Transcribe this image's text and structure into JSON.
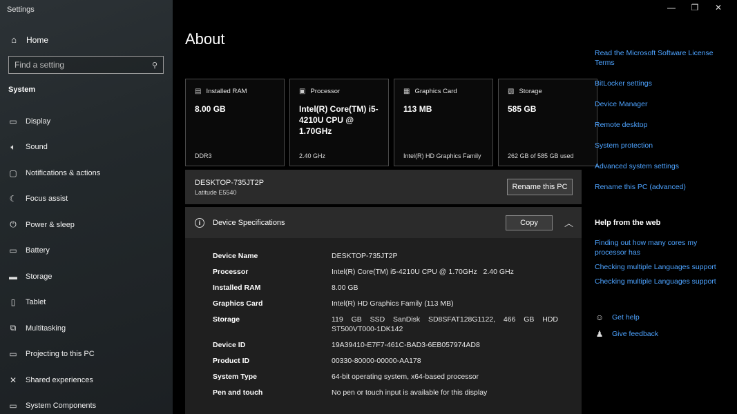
{
  "window": {
    "title": "Settings",
    "controls": [
      "—",
      "❐",
      "✕"
    ]
  },
  "sidebar": {
    "home_label": "Home",
    "search": {
      "placeholder": "Find a setting"
    },
    "section": "System",
    "items": [
      {
        "label": "Display",
        "icon": "display-icon"
      },
      {
        "label": "Sound",
        "icon": "sound-icon"
      },
      {
        "label": "Notifications & actions",
        "icon": "notifications-icon"
      },
      {
        "label": "Focus assist",
        "icon": "focus-assist-icon"
      },
      {
        "label": "Power & sleep",
        "icon": "power-icon"
      },
      {
        "label": "Battery",
        "icon": "battery-icon"
      },
      {
        "label": "Storage",
        "icon": "storage-icon"
      },
      {
        "label": "Tablet",
        "icon": "tablet-icon"
      },
      {
        "label": "Multitasking",
        "icon": "multitasking-icon"
      },
      {
        "label": "Projecting to this PC",
        "icon": "projecting-icon"
      },
      {
        "label": "Shared experiences",
        "icon": "shared-icon"
      },
      {
        "label": "System Components",
        "icon": "components-icon"
      }
    ]
  },
  "main": {
    "title": "About",
    "cards": [
      {
        "label": "Installed RAM",
        "value": "8.00 GB",
        "sub": "DDR3",
        "icon": "ram-icon"
      },
      {
        "label": "Processor",
        "value": "Intel(R) Core(TM) i5-4210U CPU @ 1.70GHz",
        "sub": "2.40 GHz",
        "icon": "processor-icon"
      },
      {
        "label": "Graphics Card",
        "value": "113 MB",
        "sub": "Intel(R) HD Graphics Family",
        "icon": "graphics-icon"
      },
      {
        "label": "Storage",
        "value": "585 GB",
        "sub": "262 GB of 585 GB used",
        "icon": "storage-icon"
      }
    ],
    "pc": {
      "name": "DESKTOP-735JT2P",
      "model": "Latitude E5540",
      "rename_label": "Rename this PC"
    },
    "specs": {
      "title": "Device Specifications",
      "copy_label": "Copy",
      "rows": [
        {
          "key": "Device Name",
          "value": "DESKTOP-735JT2P"
        },
        {
          "key": "Processor",
          "value": "Intel(R) Core(TM) i5-4210U CPU @ 1.70GHz   2.40 GHz"
        },
        {
          "key": "Installed RAM",
          "value": "8.00 GB"
        },
        {
          "key": "Graphics Card",
          "value": "Intel(R) HD Graphics Family (113 MB)"
        },
        {
          "key": "Storage",
          "value": "119 GB SSD SanDisk SD8SFAT128G1122, 466 GB HDD ST500VT000-1DK142"
        },
        {
          "key": "Device ID",
          "value": "19A39410-E7F7-461C-BAD3-6EB057974AD8"
        },
        {
          "key": "Product ID",
          "value": "00330-80000-00000-AA178"
        },
        {
          "key": "System Type",
          "value": "64-bit operating system, x64-based processor"
        },
        {
          "key": "Pen and touch",
          "value": "No pen or touch input is available for this display"
        }
      ]
    }
  },
  "related": {
    "links": [
      "Read the Microsoft Software License Terms",
      "BitLocker settings",
      "Device Manager",
      "Remote desktop",
      "System protection",
      "Advanced system settings",
      "Rename this PC (advanced)"
    ],
    "help_title": "Help from the web",
    "help_links": [
      "Finding out how many cores my processor has",
      "Checking multiple Languages support",
      "Checking multiple Languages support"
    ],
    "get_help": "Get help",
    "give_feedback": "Give feedback"
  }
}
